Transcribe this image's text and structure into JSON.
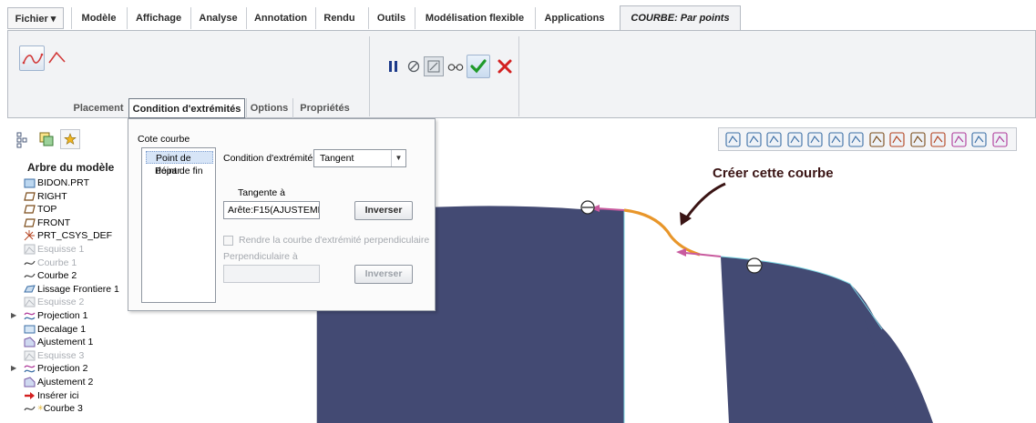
{
  "menu": {
    "file": "Fichier ▾",
    "tabs": [
      "Modèle",
      "Affichage",
      "Analyse",
      "Annotation",
      "Rendu",
      "Outils",
      "Modélisation flexible",
      "Applications"
    ],
    "active_tab": "COURBE: Par points"
  },
  "ribbon": {
    "subtabs": [
      "Placement",
      "Condition d'extrémités",
      "Options",
      "Propriétés"
    ],
    "active_subtab_index": 1
  },
  "tree": {
    "header": "Arbre du modèle",
    "items": [
      {
        "label": "BIDON.PRT",
        "icon": "part-icon",
        "dim": false
      },
      {
        "label": "RIGHT",
        "icon": "datum-plane-icon",
        "dim": false
      },
      {
        "label": "TOP",
        "icon": "datum-plane-icon",
        "dim": false
      },
      {
        "label": "FRONT",
        "icon": "datum-plane-icon",
        "dim": false
      },
      {
        "label": "PRT_CSYS_DEF",
        "icon": "csys-icon",
        "dim": false
      },
      {
        "label": "Esquisse 1",
        "icon": "sketch-icon",
        "dim": true
      },
      {
        "label": "Courbe 1",
        "icon": "curve-icon",
        "dim": true
      },
      {
        "label": "Courbe 2",
        "icon": "curve-icon",
        "dim": false
      },
      {
        "label": "Lissage Frontiere 1",
        "icon": "boundary-blend-icon",
        "dim": false
      },
      {
        "label": "Esquisse 2",
        "icon": "sketch-icon",
        "dim": true
      },
      {
        "label": "Projection 1",
        "icon": "projection-icon",
        "dim": false,
        "expandable": true
      },
      {
        "label": "Decalage 1",
        "icon": "offset-icon",
        "dim": false
      },
      {
        "label": "Ajustement 1",
        "icon": "trim-icon",
        "dim": false
      },
      {
        "label": "Esquisse 3",
        "icon": "sketch-icon",
        "dim": true
      },
      {
        "label": "Projection 2",
        "icon": "projection-icon",
        "dim": false,
        "expandable": true
      },
      {
        "label": "Ajustement 2",
        "icon": "trim-icon",
        "dim": false
      },
      {
        "label": "Insérer ici",
        "icon": "insert-arrow-icon",
        "dim": false
      },
      {
        "label": "Courbe 3",
        "icon": "curve-new-icon",
        "dim": false
      }
    ]
  },
  "dialog": {
    "title": "Cote courbe",
    "end_points": [
      "Point de dépar",
      "Point de fin"
    ],
    "selected_end_point_index": 0,
    "condition_label": "Condition d'extrémité",
    "condition_value": "Tangent",
    "tangent_label": "Tangente à",
    "tangent_value": "Arête:F15(AJUSTEMEI",
    "invert_label": "Inverser",
    "perpendicular_check_label": "Rendre la courbe d'extrémité perpendiculaire",
    "perpendicular_check_checked": false,
    "perpendicular_label": "Perpendiculaire à",
    "perpendicular_value": ""
  },
  "annotation": {
    "text": "Créer cette courbe"
  },
  "colors": {
    "surface": "#434a73",
    "curve": "#e8962a",
    "tangent_arrow": "#c85a9e",
    "edge_highlight": "#7fd8e4",
    "annotation_arrow": "#3a1414"
  }
}
